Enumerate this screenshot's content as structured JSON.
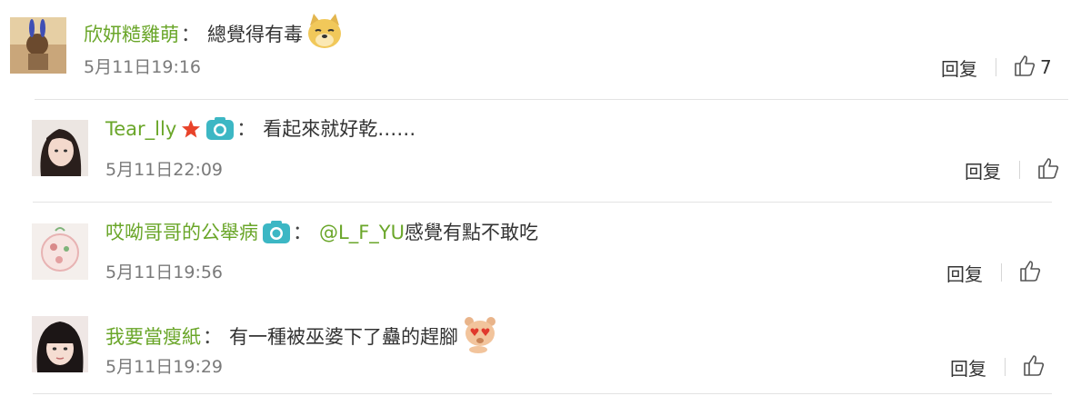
{
  "comments": [
    {
      "user": "欣妍糙雞萌",
      "colon": "：",
      "text": "總覺得有毒",
      "emoji": "doge-emoji",
      "time": "5月11日19:16",
      "reply_label": "回复",
      "like_count": "7"
    },
    {
      "user": "Tear_lly",
      "colon": "：",
      "text": "看起來就好乾……",
      "badges": [
        "star-icon",
        "camera-icon"
      ],
      "time": "5月11日22:09",
      "reply_label": "回复",
      "like_count": ""
    },
    {
      "user": "哎呦哥哥的公舉病",
      "colon": "：",
      "mention": "@L_F_YU",
      "text": "感覺有點不敢吃",
      "badges": [
        "camera-icon"
      ],
      "time": "5月11日19:56",
      "reply_label": "回复",
      "like_count": ""
    },
    {
      "user": "我要當瘦紙",
      "colon": "：",
      "text": "有一種被巫婆下了蠱的趕腳",
      "emoji": "bear-love-emoji",
      "time": "5月11日19:29",
      "reply_label": "回复",
      "like_count": ""
    }
  ],
  "colors": {
    "username": "#6aa629",
    "text": "#333333",
    "time": "#7a7a7a",
    "divider": "#e3e3e3",
    "camera_badge": "#3cb7c4",
    "star_badge": "#e8432a"
  }
}
